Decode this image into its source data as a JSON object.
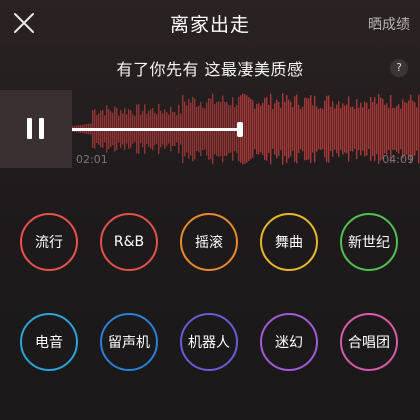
{
  "header": {
    "title": "离家出走",
    "share_label": "晒成绩",
    "close_icon": "close-icon"
  },
  "song": {
    "lyric_line": "有了你先有 这最凄美质感",
    "help_label": "?"
  },
  "player": {
    "state_icon": "pause-icon",
    "current_time": "02:01",
    "total_time": "04:09",
    "progress": 0.486,
    "waveform_color": "#b03a3a"
  },
  "genres": [
    {
      "label": "流行",
      "color": "#e8524a"
    },
    {
      "label": "R&B",
      "color": "#e0524a"
    },
    {
      "label": "摇滚",
      "color": "#e88a2a"
    },
    {
      "label": "舞曲",
      "color": "#e8b82a"
    },
    {
      "label": "新世纪",
      "color": "#4fbf4f"
    },
    {
      "label": "电音",
      "color": "#2aa4d8"
    },
    {
      "label": "留声机",
      "color": "#2a7fd8"
    },
    {
      "label": "机器人",
      "color": "#6a5ad8"
    },
    {
      "label": "迷幻",
      "color": "#a35ad8"
    },
    {
      "label": "合唱团",
      "color": "#d85aa8"
    }
  ]
}
